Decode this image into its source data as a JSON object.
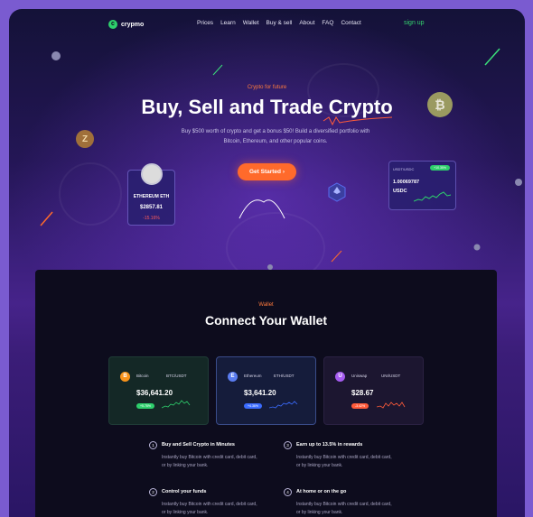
{
  "nav": {
    "logo_mark": "c",
    "logo_text": "crypmo",
    "links": [
      "Prices",
      "Learn",
      "Wallet",
      "Buy & sell",
      "About",
      "FAQ",
      "Contact"
    ],
    "signup": "sign up"
  },
  "hero": {
    "tag": "Crypto for future",
    "title": "Buy, Sell and Trade Crypto",
    "description": "Buy $500 worth of crypto and get a bonus $50! Build a diversified portfolio with Bitcoin, Ethereum, and other popular coins.",
    "cta_label": "Get Started",
    "cta_arrow": "›"
  },
  "eth_card": {
    "name": "ETHEREUM ETH",
    "price": "$2857.81",
    "change": "-15.16%"
  },
  "usdc_card": {
    "pair": "USDT/USDC",
    "badge": "+10.35%",
    "amount": "1.00069787",
    "symbol": "USDC"
  },
  "wallet_section": {
    "tag": "Wallet",
    "title": "Connect Your Wallet",
    "cards": [
      {
        "name": "Bitcoin",
        "pair": "BTC/USDT",
        "price": "$36,641.20",
        "badge": "+5.78%",
        "icon": "B",
        "accent": "#2ecf6c",
        "icon_color": "#f7931a"
      },
      {
        "name": "Ethereum",
        "pair": "ETH/USDT",
        "price": "$3,641.20",
        "badge": "+4.36%",
        "icon": "E",
        "accent": "#3b6cff",
        "icon_color": "#5a7cf0"
      },
      {
        "name": "Uniswap",
        "pair": "UNI/USDT",
        "price": "$28.67",
        "badge": "-3.42%",
        "icon": "U",
        "accent": "#ff5b3a",
        "icon_color": "#a65cf0"
      }
    ]
  },
  "features": [
    {
      "num": "1",
      "title": "Buy and Sell Crypto in Minutes",
      "desc": "Instantly buy Bitcoin with credit card, debit card, or by linking your bank."
    },
    {
      "num": "3",
      "title": "Earn up to 13.5% in rewards",
      "desc": "Instantly buy Bitcoin with credit card, debit card, or by linking your bank."
    },
    {
      "num": "2",
      "title": "Control your funds",
      "desc": "Instantly buy Bitcoin with credit card, debit card, or by linking your bank."
    },
    {
      "num": "4",
      "title": "At home or on the go",
      "desc": "Instantly buy Bitcoin with credit card, debit card, or by linking your bank."
    }
  ],
  "floating_coins": {
    "bitcoin": "₿",
    "zcash": "Z"
  },
  "colors": {
    "accent_orange": "#ff6a2b",
    "accent_green": "#2ecf6c",
    "page_bg": "#7a5bd0"
  }
}
